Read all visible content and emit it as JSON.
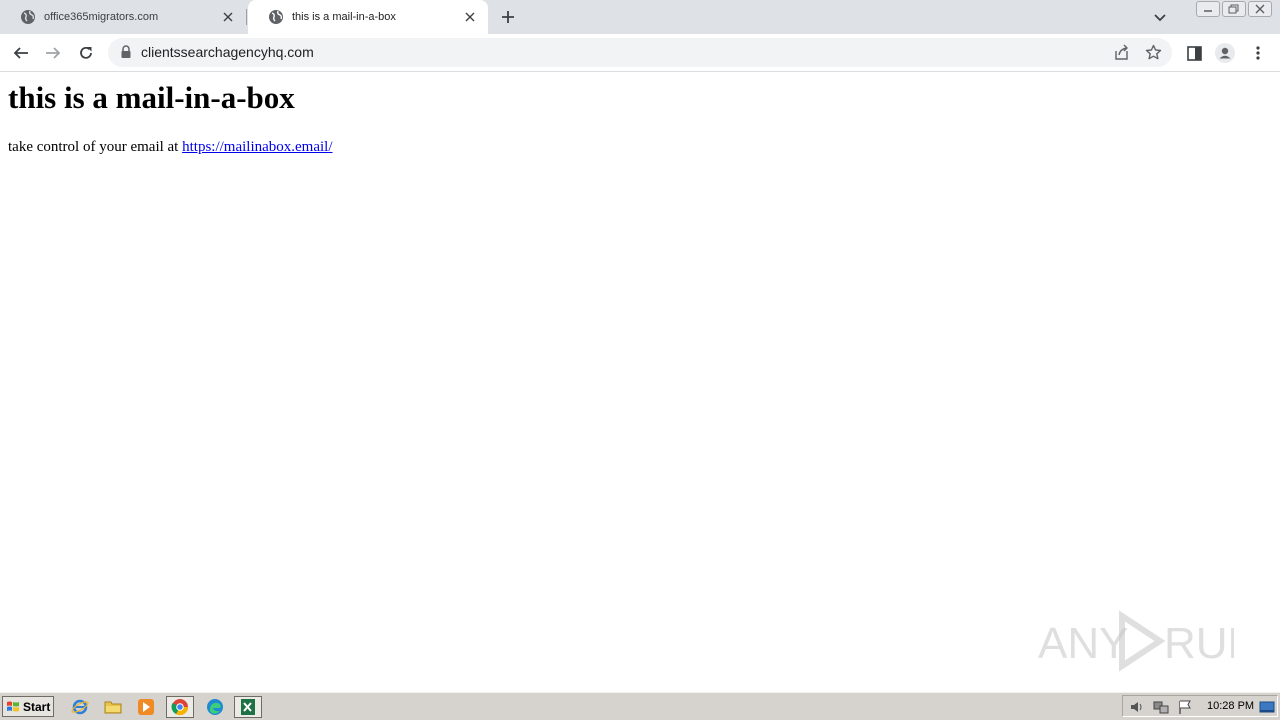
{
  "browser": {
    "tabs": [
      {
        "title": "office365migrators.com",
        "active": false
      },
      {
        "title": "this is a mail-in-a-box",
        "active": true
      }
    ],
    "url": "clientssearchagencyhq.com"
  },
  "page": {
    "heading": "this is a mail-in-a-box",
    "intro_text": "take control of your email at ",
    "link_text": "https://mailinabox.email/"
  },
  "watermark": {
    "text": "ANY RUN"
  },
  "taskbar": {
    "start_label": "Start",
    "clock": "10:28 PM",
    "apps": [
      "internet-explorer-icon",
      "file-explorer-icon",
      "media-player-icon",
      "chrome-icon",
      "edge-icon",
      "excel-icon"
    ]
  },
  "colors": {
    "link": "#0000ee",
    "tabstrip": "#dee1e6",
    "taskbar": "#d6d3ce"
  }
}
